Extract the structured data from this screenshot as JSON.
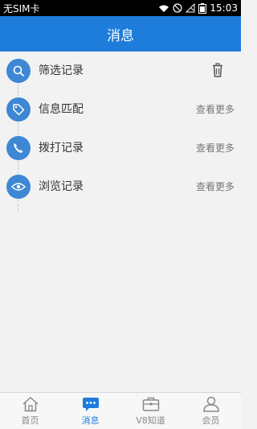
{
  "status_bar": {
    "carrier": "无SIM卡",
    "time": "15:03"
  },
  "header": {
    "title": "消息"
  },
  "list": [
    {
      "label": "筛选记录",
      "icon": "search-icon",
      "action": "trash-icon"
    },
    {
      "label": "信息匹配",
      "icon": "tag-icon",
      "more": "查看更多"
    },
    {
      "label": "拨打记录",
      "icon": "phone-icon",
      "more": "查看更多"
    },
    {
      "label": "浏览记录",
      "icon": "eye-icon",
      "more": "查看更多"
    }
  ],
  "tabs": [
    {
      "label": "首页",
      "icon": "home-icon",
      "active": false
    },
    {
      "label": "消息",
      "icon": "chat-icon",
      "active": true
    },
    {
      "label": "V8知道",
      "icon": "briefcase-icon",
      "active": false
    },
    {
      "label": "会员",
      "icon": "user-icon",
      "active": false
    }
  ],
  "colors": {
    "accent": "#1e7ddb",
    "icon_circle": "#3d87d4"
  }
}
